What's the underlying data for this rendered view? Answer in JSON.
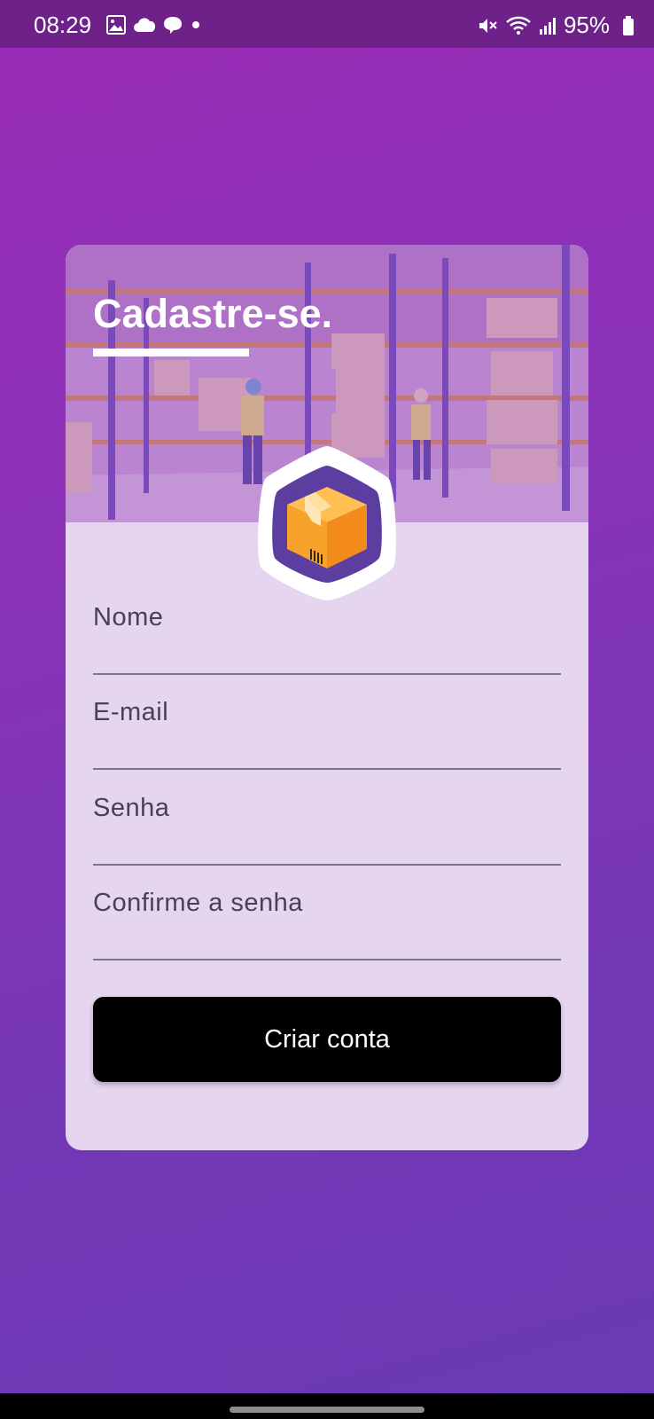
{
  "status_bar": {
    "time": "08:29",
    "battery": "95%",
    "left_icons": [
      "image-icon",
      "cloud-icon",
      "chat-icon",
      "dot-icon"
    ],
    "right_icons": [
      "mute-icon",
      "wifi-icon",
      "signal-icon",
      "battery-icon"
    ]
  },
  "signup": {
    "title": "Cadastre-se.",
    "fields": {
      "name_placeholder": "Nome",
      "email_placeholder": "E-mail",
      "password_placeholder": "Senha",
      "confirm_placeholder": "Confirme a senha"
    },
    "submit_label": "Criar conta"
  },
  "colors": {
    "background_top": "#9b2cb6",
    "background_bottom": "#6a3ab5",
    "card": "#e5d5ef",
    "button": "#000000",
    "badge_ring": "#5b3ea0",
    "box_orange": "#f7a22a"
  }
}
